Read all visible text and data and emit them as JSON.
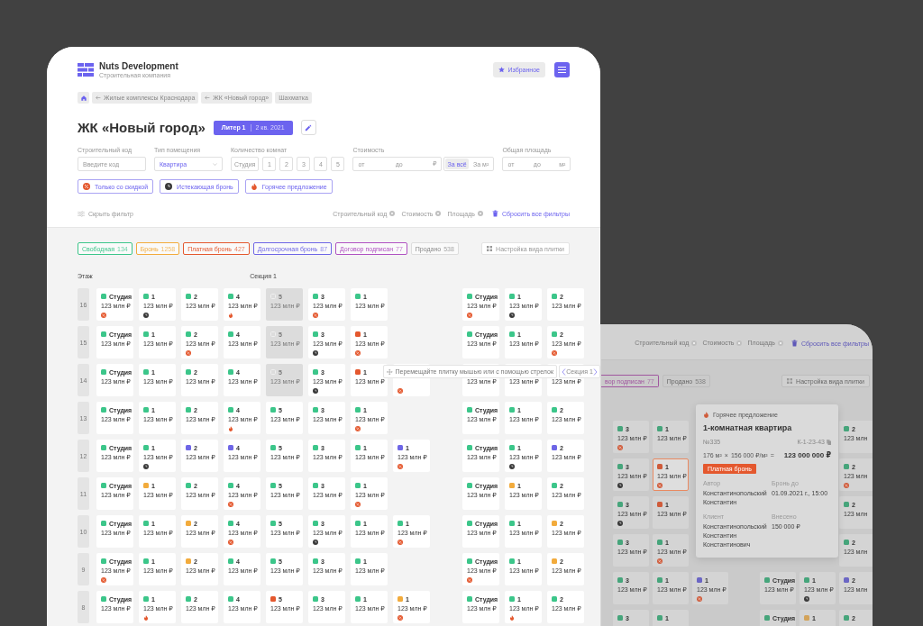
{
  "header": {
    "company": "Nuts Development",
    "subtitle": "Строительная компания",
    "favorites": "Избранное"
  },
  "breadcrumbs": [
    {
      "label": "Жилые комплексы Краснодара",
      "back": true
    },
    {
      "label": "ЖК «Новый город»",
      "back": true
    },
    {
      "label": "Шахматка",
      "back": false
    }
  ],
  "title": "ЖК «Новый город»",
  "building": {
    "name": "Литер 1",
    "deadline": "2 кв. 2021"
  },
  "filters": {
    "code": {
      "label": "Строительный код",
      "placeholder": "Введите код"
    },
    "type": {
      "label": "Тип помещения",
      "value": "Квартира"
    },
    "rooms": {
      "label": "Количество комнат",
      "options": [
        {
          "label": "Студия",
          "selected": false
        },
        {
          "label": "1",
          "selected": false
        },
        {
          "label": "2",
          "selected": false
        },
        {
          "label": "3",
          "selected": false
        },
        {
          "label": "4",
          "selected": false
        },
        {
          "label": "5",
          "selected": false
        }
      ]
    },
    "price": {
      "label": "Стоимость",
      "from": {
        "placeholder": "от"
      },
      "to": {
        "placeholder": "до"
      },
      "unit": "₽",
      "modes": [
        {
          "label": "За всё",
          "selected": true
        },
        {
          "label": "За м²",
          "selected": false
        }
      ]
    },
    "area": {
      "label": "Общая площадь",
      "from": {
        "placeholder": "от"
      },
      "to": {
        "placeholder": "до"
      },
      "unit": "м²"
    }
  },
  "quick_filters": [
    {
      "label": "Только со скидкой",
      "kind": "discount"
    },
    {
      "label": "Истекающая бронь",
      "kind": "expiring"
    },
    {
      "label": "Горячее предложение",
      "kind": "hot"
    }
  ],
  "hide_filter": "Скрыть фильтр",
  "active_filters": [
    "Строительный код",
    "Стоимость",
    "Площадь"
  ],
  "reset": "Сбросить все фильтры",
  "legend": [
    {
      "label": "Свободная",
      "count": "134",
      "color": "#3cc68a"
    },
    {
      "label": "Бронь",
      "count": "1258",
      "color": "#f2ab3c"
    },
    {
      "label": "Платная бронь",
      "count": "427",
      "color": "#e4582e"
    },
    {
      "label": "Долгосрочная бронь",
      "count": "87",
      "color": "#6e66e6"
    },
    {
      "label": "Договор подписан",
      "count": "77",
      "color": "#b052c2"
    },
    {
      "label": "Продано",
      "count": "538",
      "color": "#dddddd"
    }
  ],
  "tile_settings": "Настройка вида плитки",
  "floor_header": "Этаж",
  "section_title": "Секция 1",
  "floors": [
    {
      "floor": "16",
      "section": [
        {
          "kind": "unit",
          "rooms": "Студия",
          "price": "123 млн ₽",
          "color": "#3cc68a",
          "badge": {
            "kind": "discount"
          }
        },
        {
          "kind": "unit",
          "rooms": "1",
          "price": "123 млн ₽",
          "color": "#3cc68a",
          "badge": {
            "kind": "expiring"
          }
        },
        {
          "kind": "unit",
          "rooms": "2",
          "price": "123 млн ₽",
          "color": "#3cc68a"
        },
        {
          "kind": "unit",
          "rooms": "4",
          "price": "123 млн ₽",
          "color": "#3cc68a",
          "badge": {
            "kind": "hot"
          }
        },
        {
          "kind": "sold",
          "rooms": "5",
          "price": "123 млн ₽"
        },
        {
          "kind": "unit",
          "rooms": "3",
          "price": "123 млн ₽",
          "color": "#3cc68a",
          "badge": {
            "kind": "discount"
          }
        },
        {
          "kind": "unit",
          "rooms": "1",
          "price": "123 млн ₽",
          "color": "#3cc68a"
        }
      ],
      "next": [
        {
          "rooms": "Студия",
          "price": "123 млн ₽",
          "color": "#3cc68a",
          "badge": {
            "kind": "discount"
          }
        },
        {
          "rooms": "1",
          "price": "123 млн ₽",
          "color": "#3cc68a",
          "badge": {
            "kind": "expiring"
          }
        },
        {
          "rooms": "2",
          "price": "123 млн ₽",
          "color": "#3cc68a"
        }
      ]
    },
    {
      "floor": "15",
      "section": [
        {
          "kind": "unit",
          "rooms": "Студия",
          "price": "123 млн ₽",
          "color": "#3cc68a"
        },
        {
          "kind": "unit",
          "rooms": "1",
          "price": "123 млн ₽",
          "color": "#3cc68a"
        },
        {
          "kind": "unit",
          "rooms": "2",
          "price": "123 млн ₽",
          "color": "#3cc68a",
          "badge": {
            "kind": "discount"
          }
        },
        {
          "kind": "unit",
          "rooms": "4",
          "price": "123 млн ₽",
          "color": "#3cc68a"
        },
        {
          "kind": "sold",
          "rooms": "5",
          "price": "123 млн ₽"
        },
        {
          "kind": "unit",
          "rooms": "3",
          "price": "123 млн ₽",
          "color": "#3cc68a",
          "badge": {
            "kind": "expiring"
          }
        },
        {
          "kind": "unit",
          "rooms": "1",
          "price": "123 млн ₽",
          "color": "#e4582e",
          "badge": {
            "kind": "discount"
          }
        }
      ],
      "next": [
        {
          "rooms": "Студия",
          "price": "123 млн ₽",
          "color": "#3cc68a"
        },
        {
          "rooms": "1",
          "price": "123 млн ₽",
          "color": "#3cc68a"
        },
        {
          "rooms": "2",
          "price": "123 млн ₽",
          "color": "#3cc68a",
          "badge": {
            "kind": "discount"
          }
        }
      ]
    },
    {
      "floor": "14",
      "section": [
        {
          "kind": "unit",
          "rooms": "Студия",
          "price": "123 млн ₽",
          "color": "#3cc68a"
        },
        {
          "kind": "unit",
          "rooms": "1",
          "price": "123 млн ₽",
          "color": "#3cc68a"
        },
        {
          "kind": "unit",
          "rooms": "2",
          "price": "123 млн ₽",
          "color": "#3cc68a"
        },
        {
          "kind": "unit",
          "rooms": "4",
          "price": "123 млн ₽",
          "color": "#3cc68a"
        },
        {
          "kind": "sold",
          "rooms": "5",
          "price": "123 млн ₽"
        },
        {
          "kind": "unit",
          "rooms": "3",
          "price": "123 млн ₽",
          "color": "#3cc68a",
          "badge": {
            "kind": "expiring"
          }
        },
        {
          "kind": "unit",
          "rooms": "1",
          "price": "123 млн ₽",
          "color": "#e4582e"
        },
        {
          "kind": "unit",
          "badge": {
            "kind": "discount"
          }
        }
      ],
      "next": [
        {
          "price": "123 млн ₽"
        },
        {
          "price": "123 млн ₽"
        },
        {
          "price": "123 млн ₽"
        }
      ]
    },
    {
      "floor": "13",
      "section": [
        {
          "kind": "unit",
          "rooms": "Студия",
          "price": "123 млн ₽",
          "color": "#3cc68a"
        },
        {
          "kind": "unit",
          "rooms": "1",
          "price": "123 млн ₽",
          "color": "#3cc68a"
        },
        {
          "kind": "unit",
          "rooms": "2",
          "price": "123 млн ₽",
          "color": "#3cc68a"
        },
        {
          "kind": "unit",
          "rooms": "4",
          "price": "123 млн ₽",
          "color": "#3cc68a",
          "badge": {
            "kind": "hot"
          }
        },
        {
          "kind": "unit",
          "rooms": "5",
          "price": "123 млн ₽",
          "color": "#3cc68a"
        },
        {
          "kind": "unit",
          "rooms": "3",
          "price": "123 млн ₽",
          "color": "#3cc68a"
        },
        {
          "kind": "unit",
          "rooms": "1",
          "price": "123 млн ₽",
          "color": "#3cc68a",
          "badge": {
            "kind": "discount"
          }
        }
      ],
      "next": [
        {
          "rooms": "Студия",
          "price": "123 млн ₽",
          "color": "#3cc68a"
        },
        {
          "rooms": "1",
          "price": "123 млн ₽",
          "color": "#3cc68a"
        },
        {
          "rooms": "2",
          "price": "123 млн ₽",
          "color": "#3cc68a"
        }
      ]
    },
    {
      "floor": "12",
      "section": [
        {
          "kind": "unit",
          "rooms": "Студия",
          "price": "123 млн ₽",
          "color": "#3cc68a"
        },
        {
          "kind": "unit",
          "rooms": "1",
          "price": "123 млн ₽",
          "color": "#3cc68a",
          "badge": {
            "kind": "expiring"
          }
        },
        {
          "kind": "unit",
          "rooms": "2",
          "price": "123 млн ₽",
          "color": "#6e66e6"
        },
        {
          "kind": "unit",
          "rooms": "4",
          "price": "123 млн ₽",
          "color": "#6e66e6"
        },
        {
          "kind": "unit",
          "rooms": "5",
          "price": "123 млн ₽",
          "color": "#3cc68a"
        },
        {
          "kind": "unit",
          "rooms": "3",
          "price": "123 млн ₽",
          "color": "#3cc68a"
        },
        {
          "kind": "unit",
          "rooms": "1",
          "price": "123 млн ₽",
          "color": "#3cc68a"
        },
        {
          "kind": "unit",
          "rooms": "1",
          "price": "123 млн ₽",
          "color": "#6e66e6",
          "badge": {
            "kind": "discount"
          }
        }
      ],
      "next": [
        {
          "rooms": "Студия",
          "price": "123 млн ₽",
          "color": "#3cc68a"
        },
        {
          "rooms": "1",
          "price": "123 млн ₽",
          "color": "#3cc68a",
          "badge": {
            "kind": "expiring"
          }
        },
        {
          "rooms": "2",
          "price": "123 млн ₽",
          "color": "#6e66e6"
        }
      ]
    },
    {
      "floor": "11",
      "section": [
        {
          "kind": "unit",
          "rooms": "Студия",
          "price": "123 млн ₽",
          "color": "#3cc68a"
        },
        {
          "kind": "unit",
          "rooms": "1",
          "price": "123 млн ₽",
          "color": "#f2ab3c"
        },
        {
          "kind": "unit",
          "rooms": "2",
          "price": "123 млн ₽",
          "color": "#3cc68a"
        },
        {
          "kind": "unit",
          "rooms": "4",
          "price": "123 млн ₽",
          "color": "#3cc68a",
          "badge": {
            "kind": "discount"
          }
        },
        {
          "kind": "unit",
          "rooms": "5",
          "price": "123 млн ₽",
          "color": "#3cc68a"
        },
        {
          "kind": "unit",
          "rooms": "3",
          "price": "123 млн ₽",
          "color": "#3cc68a"
        },
        {
          "kind": "unit",
          "rooms": "1",
          "price": "123 млн ₽",
          "color": "#3cc68a",
          "badge": {
            "kind": "discount"
          }
        }
      ],
      "next": [
        {
          "rooms": "Студия",
          "price": "123 млн ₽",
          "color": "#3cc68a"
        },
        {
          "rooms": "1",
          "price": "123 млн ₽",
          "color": "#f2ab3c"
        },
        {
          "rooms": "2",
          "price": "123 млн ₽",
          "color": "#3cc68a"
        }
      ]
    },
    {
      "floor": "10",
      "section": [
        {
          "kind": "unit",
          "rooms": "Студия",
          "price": "123 млн ₽",
          "color": "#3cc68a"
        },
        {
          "kind": "unit",
          "rooms": "1",
          "price": "123 млн ₽",
          "color": "#3cc68a"
        },
        {
          "kind": "unit",
          "rooms": "2",
          "price": "123 млн ₽",
          "color": "#f2ab3c"
        },
        {
          "kind": "unit",
          "rooms": "4",
          "price": "123 млн ₽",
          "color": "#3cc68a",
          "badge": {
            "kind": "discount"
          }
        },
        {
          "kind": "unit",
          "rooms": "5",
          "price": "123 млн ₽",
          "color": "#3cc68a"
        },
        {
          "kind": "unit",
          "rooms": "3",
          "price": "123 млн ₽",
          "color": "#3cc68a",
          "badge": {
            "kind": "expiring"
          }
        },
        {
          "kind": "unit",
          "rooms": "1",
          "price": "123 млн ₽",
          "color": "#3cc68a"
        },
        {
          "kind": "unit",
          "rooms": "1",
          "price": "123 млн ₽",
          "color": "#3cc68a",
          "badge": {
            "kind": "discount"
          }
        }
      ],
      "next": [
        {
          "rooms": "Студия",
          "price": "123 млн ₽",
          "color": "#3cc68a"
        },
        {
          "rooms": "1",
          "price": "123 млн ₽",
          "color": "#3cc68a"
        },
        {
          "rooms": "2",
          "price": "123 млн ₽",
          "color": "#f2ab3c"
        }
      ]
    },
    {
      "floor": "9",
      "section": [
        {
          "kind": "unit",
          "rooms": "Студия",
          "price": "123 млн ₽",
          "color": "#3cc68a",
          "badge": {
            "kind": "discount"
          }
        },
        {
          "kind": "unit",
          "rooms": "1",
          "price": "123 млн ₽",
          "color": "#3cc68a"
        },
        {
          "kind": "unit",
          "rooms": "2",
          "price": "123 млн ₽",
          "color": "#f2ab3c"
        },
        {
          "kind": "unit",
          "rooms": "4",
          "price": "123 млн ₽",
          "color": "#3cc68a"
        },
        {
          "kind": "unit",
          "rooms": "5",
          "price": "123 млн ₽",
          "color": "#3cc68a"
        },
        {
          "kind": "unit",
          "rooms": "3",
          "price": "123 млн ₽",
          "color": "#3cc68a"
        },
        {
          "kind": "unit",
          "rooms": "1",
          "price": "123 млн ₽",
          "color": "#3cc68a"
        }
      ],
      "next": [
        {
          "rooms": "Студия",
          "price": "123 млн ₽",
          "color": "#3cc68a",
          "badge": {
            "kind": "discount"
          }
        },
        {
          "rooms": "1",
          "price": "123 млн ₽",
          "color": "#3cc68a"
        },
        {
          "rooms": "2",
          "price": "123 млн ₽",
          "color": "#f2ab3c"
        }
      ]
    },
    {
      "floor": "8",
      "section": [
        {
          "kind": "unit",
          "rooms": "Студия",
          "price": "123 млн ₽",
          "color": "#3cc68a"
        },
        {
          "kind": "unit",
          "rooms": "1",
          "price": "123 млн ₽",
          "color": "#3cc68a",
          "badge": {
            "kind": "hot"
          }
        },
        {
          "kind": "unit",
          "rooms": "2",
          "price": "123 млн ₽",
          "color": "#3cc68a"
        },
        {
          "kind": "unit",
          "rooms": "4",
          "price": "123 млн ₽",
          "color": "#3cc68a"
        },
        {
          "kind": "unit",
          "rooms": "5",
          "price": "123 млн ₽",
          "color": "#e4582e"
        },
        {
          "kind": "unit",
          "rooms": "3",
          "price": "123 млн ₽",
          "color": "#3cc68a"
        },
        {
          "kind": "unit",
          "rooms": "1",
          "price": "123 млн ₽",
          "color": "#3cc68a"
        },
        {
          "kind": "unit",
          "rooms": "1",
          "price": "123 млн ₽",
          "color": "#f2ab3c",
          "badge": {
            "kind": "discount"
          }
        }
      ],
      "next": [
        {
          "rooms": "Студия",
          "price": "123 млн ₽",
          "color": "#3cc68a"
        },
        {
          "rooms": "1",
          "price": "123 млн ₽",
          "color": "#3cc68a",
          "badge": {
            "kind": "hot"
          }
        },
        {
          "rooms": "2",
          "price": "123 млн ₽",
          "color": "#3cc68a"
        }
      ]
    }
  ],
  "hint": "Перемещайте плитку мышью или с помощью стрелок",
  "section_nav": "Секция 1",
  "preview": {
    "active_filters": [
      "Строительный код",
      "Стоимость",
      "Площадь"
    ],
    "reset": "Сбросить все фильтры",
    "legend": [
      {
        "label": "вор подписан",
        "count": "77",
        "color": "#a0569f"
      },
      {
        "label": "Продано",
        "count": "538",
        "color": "#bdbdbd"
      }
    ],
    "tile_settings": "Настройка вида плитки",
    "rows": [
      {
        "left": [
          {
            "rooms": "3",
            "price": "123 млн ₽",
            "color": "#46a57b",
            "badge": {
              "kind": "discount"
            },
            "selected": false
          },
          {
            "rooms": "1",
            "price": "123 млн ₽",
            "color": "#46a57b",
            "selected": false
          }
        ],
        "right": [
          {
            "rooms": "2",
            "price": "123 млн",
            "color": "#46a57b",
            "selected": false
          }
        ]
      },
      {
        "left": [
          {
            "rooms": "3",
            "price": "123 млн ₽",
            "color": "#46a57b",
            "badge": {
              "kind": "expiring"
            },
            "selected": false
          },
          {
            "rooms": "1",
            "price": "123 млн ₽",
            "color": "#cf5b3a",
            "badge": {
              "kind": "discount"
            },
            "selected": true
          }
        ],
        "right": [
          {
            "rooms": "2",
            "price": "123 млн",
            "color": "#46a57b",
            "badge": {
              "kind": "discount"
            },
            "selected": false
          }
        ]
      },
      {
        "left": [
          {
            "rooms": "3",
            "price": "123 млн ₽",
            "color": "#46a57b",
            "badge": {
              "kind": "expiring"
            },
            "selected": false
          },
          {
            "rooms": "1",
            "price": "123 млн ₽",
            "color": "#cf5b3a",
            "selected": false
          }
        ],
        "right": [
          {
            "rooms": "2",
            "price": "123 млн",
            "color": "#46a57b",
            "selected": false
          }
        ]
      },
      {
        "left": [
          {
            "rooms": "3",
            "price": "123 млн ₽",
            "color": "#46a57b",
            "selected": false
          },
          {
            "rooms": "1",
            "price": "123 млн ₽",
            "color": "#46a57b",
            "badge": {
              "kind": "discount"
            },
            "selected": false
          }
        ],
        "right": [
          {
            "rooms": "2",
            "price": "123 млн",
            "color": "#46a57b",
            "selected": false
          }
        ]
      },
      {
        "left": [
          {
            "rooms": "3",
            "price": "123 млн ₽",
            "color": "#46a57b",
            "selected": false
          },
          {
            "rooms": "1",
            "price": "123 млн ₽",
            "color": "#46a57b",
            "selected": false
          },
          {
            "rooms": "1",
            "price": "123 млн ₽",
            "color": "#6b66c4",
            "badge": {
              "kind": "discount"
            },
            "selected": false
          }
        ],
        "right": [
          {
            "rooms": "Студия",
            "price": "123 млн ₽",
            "color": "#46a57b",
            "selected": false
          },
          {
            "rooms": "1",
            "price": "123 млн ₽",
            "color": "#46a57b",
            "badge": {
              "kind": "expiring"
            },
            "selected": false
          },
          {
            "rooms": "2",
            "price": "123 млн",
            "color": "#6b66c4",
            "selected": false
          }
        ]
      },
      {
        "left": [
          {
            "rooms": "3",
            "color": "#46a57b",
            "selected": false
          },
          {
            "rooms": "1",
            "color": "#46a57b",
            "selected": false
          }
        ],
        "right": [
          {
            "rooms": "Студия",
            "color": "#46a57b",
            "selected": false
          },
          {
            "rooms": "1",
            "color": "#d3a35a",
            "selected": false
          },
          {
            "rooms": "2",
            "color": "#46a57b",
            "selected": false
          }
        ]
      }
    ],
    "popup": {
      "badge": "Горячее предложение",
      "title": "1-комнатная квартира",
      "number": "№335",
      "code": "К-1-23-43",
      "area": "176 м²",
      "times": "×",
      "unit_price": "156 000 ₽/м²",
      "equals": "=",
      "total": "123 000 000 ₽",
      "status": {
        "label": "Платная бронь",
        "color": "#e4582e"
      },
      "fields": [
        {
          "label": "Автор",
          "value": "Константинопольский Константин"
        },
        {
          "label": "Бронь до",
          "value": "01.09.2021 г., 15:00"
        },
        {
          "label": "Клиент",
          "value": "Константинопольский Константин Константинович"
        },
        {
          "label": "Внесено",
          "value": "150 000 ₽"
        }
      ]
    }
  }
}
